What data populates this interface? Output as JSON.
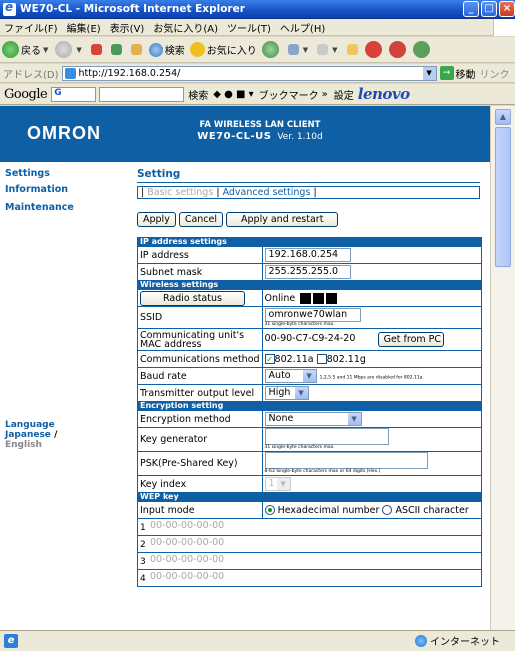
{
  "window": {
    "title": "WE70-CL - Microsoft Internet Explorer"
  },
  "menubar": {
    "items": [
      "ファイル(F)",
      "編集(E)",
      "表示(V)",
      "お気に入り(A)",
      "ツール(T)",
      "ヘルプ(H)"
    ]
  },
  "toolbar": {
    "back": "戻る",
    "search": "検索",
    "favorites": "お気に入り"
  },
  "addressbar": {
    "label": "アドレス(D)",
    "url": "http://192.168.0.254/",
    "go": "移動",
    "links": "リンク"
  },
  "googlebar": {
    "logo": "Google",
    "g": "G",
    "search": "検索",
    "bookmarks": "ブックマーク",
    "settings": "設定",
    "brand": "lenovo"
  },
  "header": {
    "logo": "OMRON",
    "product": "FA WIRELESS LAN CLIENT",
    "model": "WE70-CL-US",
    "version": "Ver. 1.10d"
  },
  "sidebar": {
    "items": [
      "Settings",
      "Information",
      "Maintenance"
    ],
    "language": "Language",
    "japanese": "Japanese",
    "slash": "/",
    "english": "English"
  },
  "main": {
    "title": "Setting",
    "tab_basic": "Basic settings",
    "tab_advanced": "Advanced settings",
    "sep": "|",
    "buttons": {
      "apply": "Apply",
      "cancel": "Cancel",
      "apply_restart": "Apply and restart"
    },
    "ip": {
      "section": "IP address settings",
      "ip_label": "IP address",
      "ip_value": "192.168.0.254",
      "mask_label": "Subnet mask",
      "mask_value": "255.255.255.0"
    },
    "wireless": {
      "section": "Wireless settings",
      "radio_status_button": "Radio status",
      "status": "Online",
      "ssid_label": "SSID",
      "ssid_value": "omronwe70wlan",
      "ssid_note": "31 single-byte characters max.",
      "mac_label": "Communicating unit's MAC address",
      "mac_value": "00-90-C7-C9-24-20",
      "get_pc": "Get from PC",
      "method_label": "Communications method",
      "opt_a": "802.11a",
      "opt_g": "802.11g",
      "baud_label": "Baud rate",
      "baud_value": "Auto",
      "baud_note": "1,2,5.5 and 11 Mbps are disabled for 802.11a.",
      "power_label": "Transmitter output level",
      "power_value": "High"
    },
    "encryption": {
      "section": "Encryption setting",
      "method_label": "Encryption method",
      "method_value": "None",
      "keygen_label": "Key generator",
      "keygen_note": "31 single-byte characters max.",
      "psk_label": "PSK(Pre-Shared Key)",
      "psk_note": "8-63 Single-byte characters max or 64 digits (Hex.)",
      "index_label": "Key index",
      "index_value": "1"
    },
    "wep": {
      "section": "WEP key",
      "input_mode_label": "Input mode",
      "hex": "Hexadecimal number",
      "ascii": "ASCII character",
      "keys": [
        {
          "n": "1",
          "ph": "00-00-00-00-00"
        },
        {
          "n": "2",
          "ph": "00-00-00-00-00"
        },
        {
          "n": "3",
          "ph": "00-00-00-00-00"
        },
        {
          "n": "4",
          "ph": "00-00-00-00-00"
        }
      ]
    }
  },
  "statusbar": {
    "zone": "インターネット"
  }
}
